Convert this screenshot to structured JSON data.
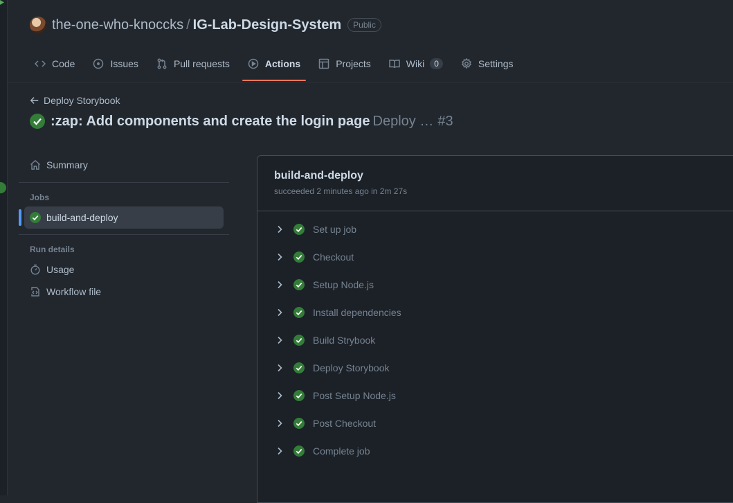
{
  "repo": {
    "owner": "the-one-who-knoccks",
    "separator": "/",
    "name": "IG-Lab-Design-System",
    "visibility": "Public"
  },
  "nav": {
    "tabs": [
      {
        "label": "Code",
        "icon": "code-icon"
      },
      {
        "label": "Issues",
        "icon": "issue-icon"
      },
      {
        "label": "Pull requests",
        "icon": "pull-request-icon"
      },
      {
        "label": "Actions",
        "icon": "play-icon",
        "active": true
      },
      {
        "label": "Projects",
        "icon": "table-icon"
      },
      {
        "label": "Wiki",
        "icon": "book-icon",
        "count": "0"
      },
      {
        "label": "Settings",
        "icon": "gear-icon"
      }
    ]
  },
  "run": {
    "back_label": "Deploy Storybook",
    "title": ":zap: Add components and create the login page",
    "workflow_short": "Deploy …",
    "number": "#3",
    "status": "success"
  },
  "sidebar": {
    "summary": "Summary",
    "jobs_heading": "Jobs",
    "jobs": [
      {
        "label": "build-and-deploy",
        "selected": true
      }
    ],
    "run_details_heading": "Run details",
    "usage": "Usage",
    "workflow_file": "Workflow file"
  },
  "job": {
    "title": "build-and-deploy",
    "status_text": "succeeded 2 minutes ago in 2m 27s",
    "steps": [
      "Set up job",
      "Checkout",
      "Setup Node.js",
      "Install dependencies",
      "Build Strybook",
      "Deploy Storybook",
      "Post Setup Node.js",
      "Post Checkout",
      "Complete job"
    ]
  },
  "colors": {
    "success": "#347d39",
    "active_underline": "#ec775c",
    "selected_marker": "#539bf5",
    "background": "#22272e"
  }
}
